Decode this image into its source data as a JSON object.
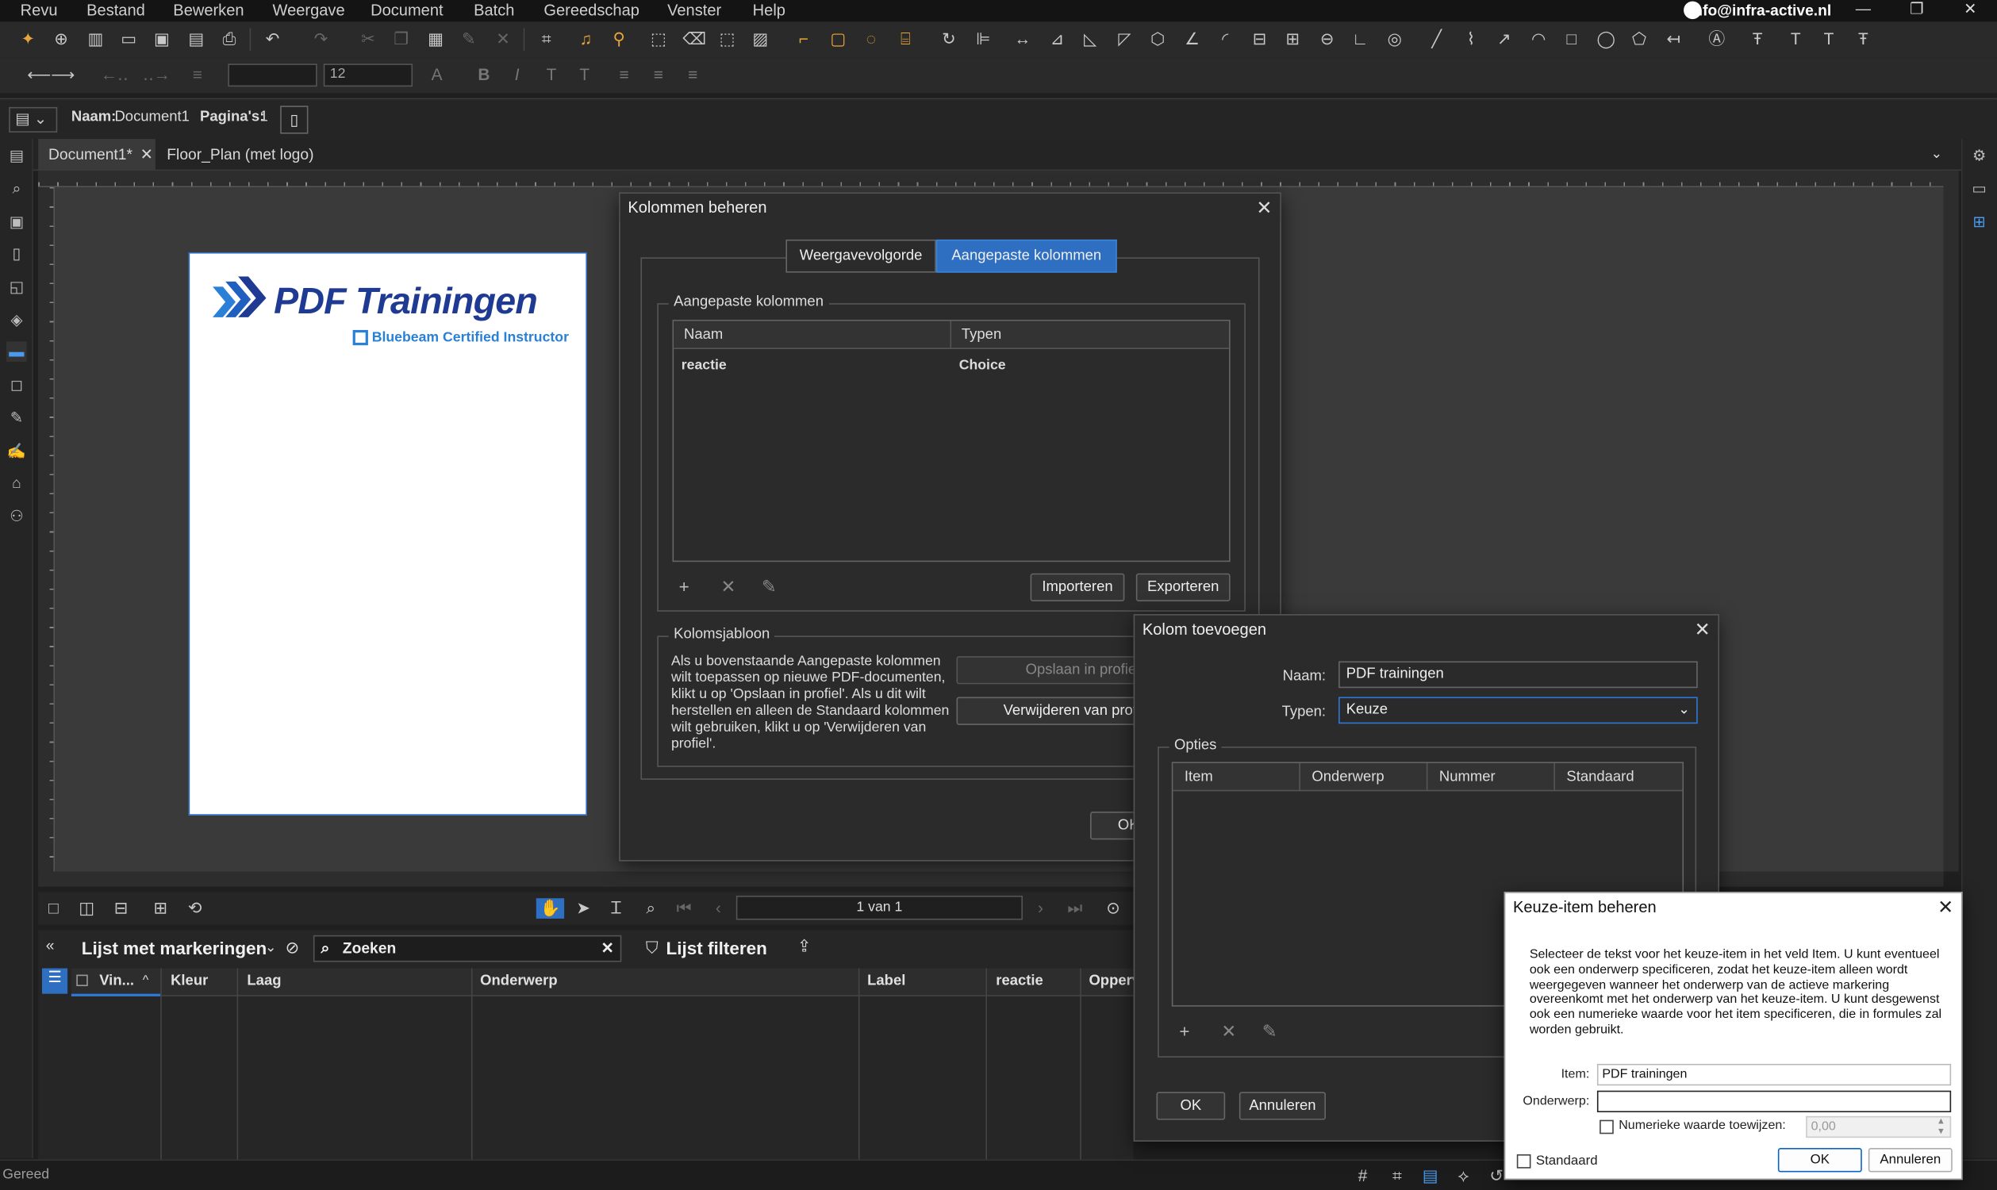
{
  "app": {
    "menu": [
      "Revu",
      "Bestand",
      "Bewerken",
      "Weergave",
      "Document",
      "Batch",
      "Gereedschap",
      "Venster",
      "Help"
    ],
    "user_email": "info@infra-active.nl",
    "window_controls": {
      "minimize": "—",
      "restore": "❐",
      "close": "✕"
    }
  },
  "toolbar2": {
    "font_size": "12"
  },
  "docbar": {
    "name_label": "Naam:",
    "name_value": "Document1",
    "pages_label": "Pagina's:",
    "pages_value": "1"
  },
  "tabs": [
    {
      "label": "Document1*",
      "active": true,
      "close": "✕"
    },
    {
      "label": "Floor_Plan (met logo)",
      "active": false
    }
  ],
  "page_logo": {
    "title": "PDF Trainingen",
    "subtitle": "Bluebeam Certified Instructor",
    "brand_color": "#1f3a93",
    "accent_color": "#2a7fd6"
  },
  "navbar": {
    "page_indicator": "1 van 1"
  },
  "markups": {
    "title": "Lijst met markeringen",
    "search_placeholder": "Zoeken",
    "filter_label": "Lijst filteren",
    "columns": [
      "Vin...",
      "Kleur",
      "Laag",
      "Onderwerp",
      "Label",
      "reactie",
      "Opperv"
    ]
  },
  "status": {
    "text": "Gereed"
  },
  "dlg_kolommen": {
    "title": "Kolommen beheren",
    "tab_order": "Weergavevolgorde",
    "tab_custom": "Aangepaste kolommen",
    "group_custom": "Aangepaste kolommen",
    "col_name": "Naam",
    "col_type": "Typen",
    "rows": [
      {
        "name": "reactie",
        "type": "Choice"
      }
    ],
    "btn_import": "Importeren",
    "btn_export": "Exporteren",
    "group_template": "Kolomsjabloon",
    "template_text": "Als u bovenstaande Aangepaste kolommen wilt toepassen op nieuwe PDF-documenten, klikt u op 'Opslaan in profiel'. Als u dit wilt herstellen en alleen de Standaard kolommen wilt gebruiken, klikt u op 'Verwijderen van profiel'.",
    "btn_save_profile": "Opslaan in profiel",
    "btn_remove_profile": "Verwijderen van profiel",
    "btn_ok": "OK"
  },
  "dlg_kolom_toevoegen": {
    "title": "Kolom toevoegen",
    "name_label": "Naam:",
    "name_value": "PDF trainingen",
    "type_label": "Typen:",
    "type_value": "Keuze",
    "group_options": "Opties",
    "columns": [
      "Item",
      "Onderwerp",
      "Nummer",
      "Standaard"
    ],
    "btn_ok": "OK",
    "btn_cancel": "Annuleren"
  },
  "dlg_keuze": {
    "title": "Keuze-item beheren",
    "description": "Selecteer de tekst voor het keuze-item in het veld Item. U kunt eventueel ook een onderwerp specificeren, zodat het keuze-item alleen wordt weergegeven wanneer het onderwerp van de actieve markering overeenkomt met het onderwerp van het keuze-item. U kunt desgewenst ook een numerieke waarde voor het item specificeren, die in formules zal worden gebruikt.",
    "item_label": "Item:",
    "item_value": "PDF trainingen",
    "subject_label": "Onderwerp:",
    "subject_value": "",
    "numeric_label": "Numerieke waarde toewijzen:",
    "numeric_value": "0,00",
    "numeric_checked": false,
    "default_label": "Standaard",
    "default_checked": false,
    "btn_ok": "OK",
    "btn_cancel": "Annuleren"
  }
}
